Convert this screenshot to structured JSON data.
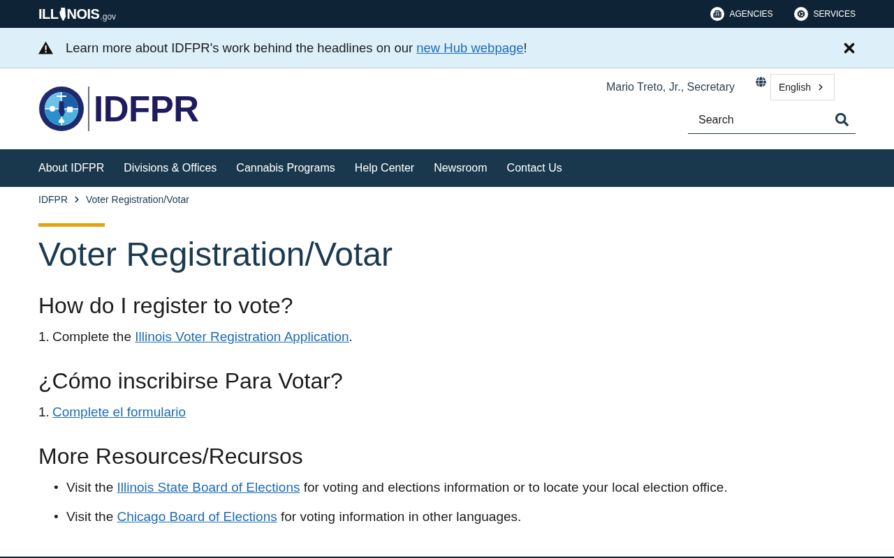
{
  "top_bar": {
    "brand": {
      "start": "ILL",
      "end": "NOIS",
      "suffix": ".gov"
    },
    "links": [
      {
        "label": "AGENCIES"
      },
      {
        "label": "SERVICES"
      }
    ]
  },
  "alert": {
    "text": "Learn more about IDFPR's work behind the headlines on our ",
    "link": "new Hub webpage",
    "after": "!"
  },
  "header": {
    "wordmark": "IDFPR",
    "secretary": "Mario Treto, Jr., Secretary",
    "language": "English",
    "search": {
      "placeholder": "Search"
    }
  },
  "nav": {
    "items": [
      "About IDFPR",
      "Divisions & Offices",
      "Cannabis Programs",
      "Help Center",
      "Newsroom",
      "Contact Us"
    ]
  },
  "breadcrumb": [
    "IDFPR",
    "Voter Registration/Votar"
  ],
  "page": {
    "title": "Voter Registration/Votar",
    "sections": [
      {
        "heading": "How do I register to vote?",
        "kind": "ordered",
        "items": [
          {
            "marker": "1.",
            "before": "Complete the ",
            "link": "Illinois Voter Registration Application",
            "after": "."
          }
        ]
      },
      {
        "heading": "¿Cómo inscribirse Para Votar?",
        "kind": "ordered",
        "items": [
          {
            "marker": "1.",
            "link": "Complete el formulario"
          }
        ]
      },
      {
        "heading": "More Resources/Recursos",
        "kind": "bulleted",
        "items": [
          {
            "marker": "•",
            "before": "Visit the ",
            "link": "Illinois State Board of Elections",
            "after": " for voting and elections information or to locate your local election office."
          },
          {
            "marker": "•",
            "before": "Visit the ",
            "link": "Chicago Board of Elections",
            "after": " for voting information in other languages."
          }
        ]
      }
    ]
  }
}
